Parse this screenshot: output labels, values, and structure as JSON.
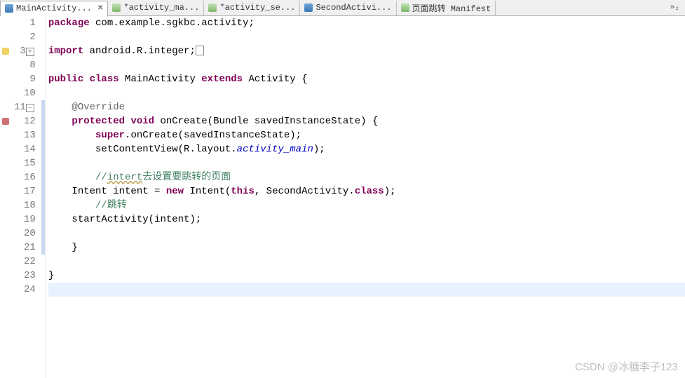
{
  "tabs": [
    {
      "label": "MainActivity...",
      "type": "j",
      "active": true,
      "closable": true
    },
    {
      "label": "*activity_ma...",
      "type": "x",
      "active": false
    },
    {
      "label": "*activity_se...",
      "type": "x",
      "active": false
    },
    {
      "label": "SecondActivi...",
      "type": "j",
      "active": false
    },
    {
      "label": "页面跳转 Manifest",
      "type": "x",
      "active": false
    }
  ],
  "more": "»₂",
  "lines": {
    "n1": "1",
    "n2": "2",
    "n3": "3",
    "n8": "8",
    "n9": "9",
    "n10": "10",
    "n11": "11",
    "n12": "12",
    "n13": "13",
    "n14": "14",
    "n15": "15",
    "n16": "16",
    "n17": "17",
    "n18": "18",
    "n19": "19",
    "n20": "20",
    "n21": "21",
    "n22": "22",
    "n23": "23",
    "n24": "24"
  },
  "code": {
    "pkg_kw": "package",
    "pkg": " com.example.sgkbc.activity;",
    "imp_kw": "import",
    "imp": " android.R.integer;",
    "pub": "public ",
    "cls": "class ",
    "cname": "MainActivity ",
    "ext": "extends ",
    "sname": "Activity {",
    "ovr": "@Override",
    "prot": "protected ",
    "vd": "void ",
    "on": "onCreate(Bundle savedInstanceState) {",
    "sup_kw": "super",
    "sup": ".onCreate(savedInstanceState);",
    "setc": "setContentView(R.layout.",
    "am": "activity_main",
    "setc2": ");",
    "c1": "//",
    "c1u": "intert",
    "c1r": "去设置要跳转的页面",
    "int1": "Intent intent = ",
    "new_kw": "new ",
    "int2": "Intent(",
    "this_kw": "this",
    "int3": ", SecondActivity.",
    "class_kw": "class",
    "int4": ");",
    "c2": "//跳转",
    "sa": "startActivity(intent);",
    "cb": "}",
    "cb2": "}"
  },
  "watermark": "CSDN @冰糖李子123"
}
